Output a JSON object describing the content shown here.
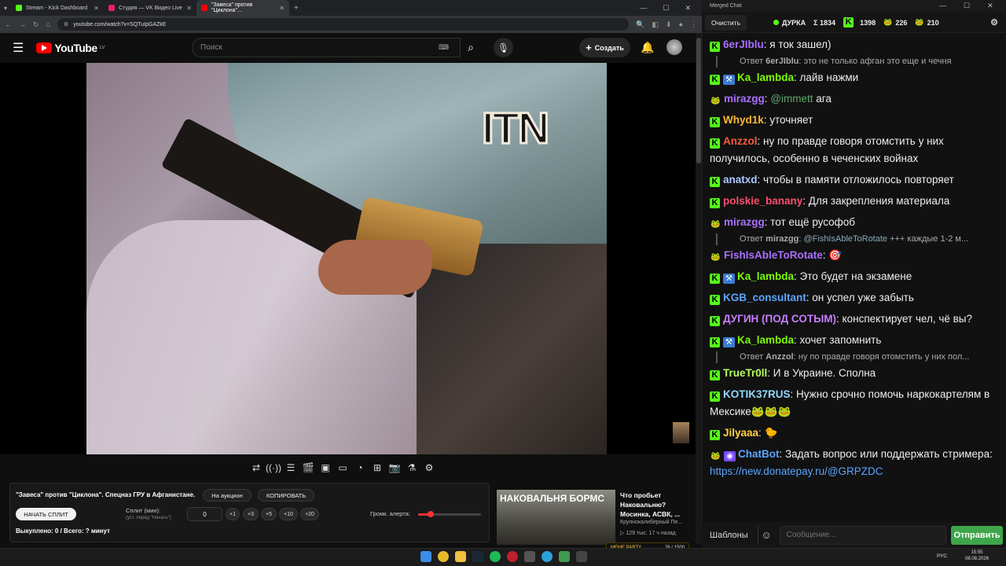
{
  "browser": {
    "tabs": [
      {
        "title": "Stream - Kick Dashboard",
        "color": "#53fc18"
      },
      {
        "title": "Студия — VK Видео Live",
        "color": "#e2245a"
      },
      {
        "title": "\"Завеса\" против \"Циклона\"...",
        "color": "#ff0000"
      }
    ],
    "url": "youtube.com/watch?v=SQTuIpGAZkE"
  },
  "youtube": {
    "logo_text": "YouTube",
    "logo_country": "LV",
    "search_placeholder": "Поиск",
    "create_label": "Создать",
    "video_overlay": "ITN"
  },
  "panel": {
    "title": "\"Завеса\" против \"Циклона\". Спецназ ГРУ в Афганистане.",
    "auction_label": "На аукцион",
    "copy_label": "КОПИРОВАТЬ",
    "start_split_label": "НАЧАТЬ СПЛИТ",
    "split_label": "Сплит (мин):",
    "split_hint": "(уст. перед \"Начать\")",
    "split_value": "0",
    "increments": [
      "+1",
      "+3",
      "+5",
      "+10",
      "+20"
    ],
    "bought": "Выкуплено: 0 / Всего: ? минут",
    "alert_volume_label": "Громк. алерта:",
    "alert_volume": 0.2
  },
  "recommended": {
    "thumb_text": "НАКОВАЛЬНЯ БОРМС",
    "title": "Что пробьет Наковальню? Мосинка, АСВК, ...",
    "channel": "Крупнокалиберный Пе...",
    "meta": "▷ 129 тыс.  17 ч назад"
  },
  "meme_party": {
    "label": "MEME PARTY",
    "count": "76 / 1500"
  },
  "taskbar": {
    "lang": "РУС",
    "time": "15:55",
    "date": "08.08.2026"
  },
  "chat": {
    "window_title": "Merged Chat",
    "clear_label": "Очистить",
    "streamer": "ДУРКА",
    "total": "Σ 1834",
    "kick_count": "1398",
    "vk_count": "226",
    "other_count": "210",
    "messages": [
      {
        "platform": "kick",
        "user": "6erJIblu",
        "color": "#a970ff",
        "text": ": я ток зашел)"
      },
      {
        "reply": true,
        "prefix": "Ответ",
        "user": "6erJIblu",
        "text": ": это не только афган это еще и чечня"
      },
      {
        "platform": "kick",
        "mod": true,
        "user": "Ka_lambda",
        "color": "#7cfc00",
        "text": ": лайв нажми"
      },
      {
        "platform": "vk",
        "user": "mirazgg",
        "color": "#a970ff",
        "mention": "@immett",
        "text": " ага"
      },
      {
        "platform": "kick",
        "user": "Whyd1k",
        "color": "#ffb830",
        "text": ": уточняет"
      },
      {
        "platform": "kick",
        "user": "Anzzol",
        "color": "#ff5a3c",
        "text": ": ну по правде говоря отомстить у них получилось, особенно в чеченских войнах"
      },
      {
        "platform": "kick",
        "user": "anatxd",
        "color": "#a9c8ff",
        "text": ": чтобы в памяти отложилось повторяет"
      },
      {
        "platform": "kick",
        "user": "polskie_banany",
        "color": "#ff4d6d",
        "text": ": Для закрепления материала"
      },
      {
        "platform": "vk",
        "user": "mirazgg",
        "color": "#a970ff",
        "text": ": тот ещё русофоб"
      },
      {
        "reply": true,
        "prefix": "Ответ",
        "user": "mirazgg",
        "mention": "@FishIsAbleToRotate",
        "text": " +++ каждые 1-2 м..."
      },
      {
        "platform": "vk",
        "user": "FishIsAbleToRotate",
        "color": "#a970ff",
        "text": ": 🎯"
      },
      {
        "platform": "kick",
        "mod": true,
        "user": "Ka_lambda",
        "color": "#7cfc00",
        "text": ": Это будет на экзамене"
      },
      {
        "platform": "kick",
        "user": "KGB_consultant",
        "color": "#5aa5ff",
        "text": ": он успел уже забыть"
      },
      {
        "platform": "kick",
        "user": "ДУГИН (ПОД СОТЫМ)",
        "color": "#c77dff",
        "text": ": конспектирует чел, чё вы?"
      },
      {
        "platform": "kick",
        "mod": true,
        "user": "Ka_lambda",
        "color": "#7cfc00",
        "text": ": хочет запомнить"
      },
      {
        "reply": true,
        "prefix": "Ответ",
        "user": "Anzzol",
        "text": ": ну по правде говоря отомстить у них пол..."
      },
      {
        "platform": "kick",
        "user": "TrueTr0ll",
        "color": "#b5ff5a",
        "text": ": И в Украине. Сполна"
      },
      {
        "platform": "kick",
        "user": "KOTIK37RUS",
        "color": "#8fd8ff",
        "text": ": Нужно срочно помочь наркокартелям в Мексике🐸🐸🐸"
      },
      {
        "platform": "kick",
        "user": "Jilyaaa",
        "color": "#ffd23f",
        "text": ": 🐤"
      },
      {
        "platform": "vk",
        "bot": true,
        "user": "ChatBot",
        "color": "#5aa5ff",
        "text": ": Задать вопрос или поддержать стримера: ",
        "link": "https://new.donatepay.ru/@GRPZDC"
      }
    ],
    "templates_label": "Шаблоны",
    "input_placeholder": "Сообщение...",
    "send_label": "Отправить"
  }
}
